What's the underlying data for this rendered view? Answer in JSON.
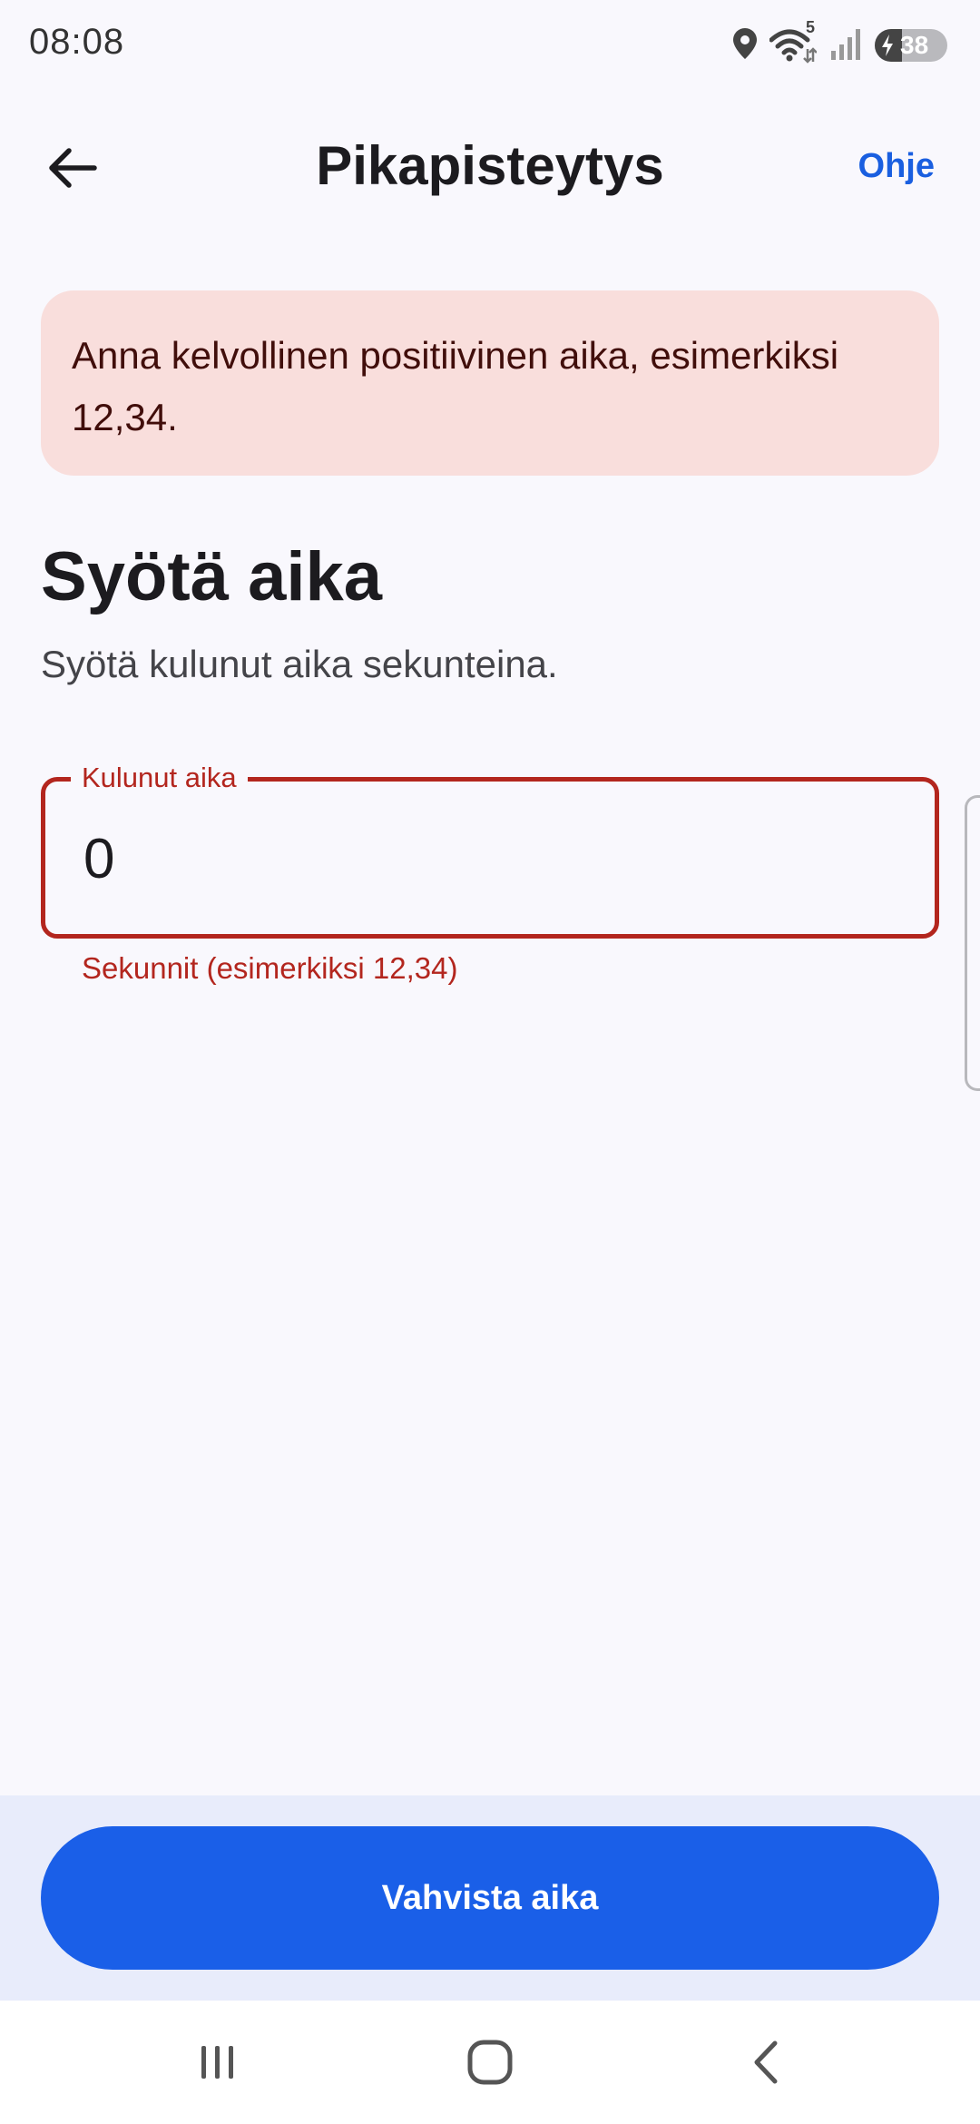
{
  "status_bar": {
    "time": "08:08",
    "wifi_badge": "5",
    "battery_level": "38",
    "icons": [
      "location-icon",
      "wifi-icon",
      "signal-icon",
      "battery-icon"
    ]
  },
  "app_bar": {
    "title": "Pikapisteytys",
    "help_label": "Ohje",
    "back_icon": "arrow-left-icon"
  },
  "error_banner": {
    "message": "Anna kelvollinen positiivinen aika, esimerkiksi 12,34."
  },
  "section": {
    "title": "Syötä aika",
    "subtitle": "Syötä kulunut aika sekunteina."
  },
  "time_field": {
    "label": "Kulunut aika",
    "value": "0",
    "supporting_text": "Sekunnit (esimerkiksi 12,34)",
    "state": "error"
  },
  "actions": {
    "confirm_label": "Vahvista aika"
  },
  "nav_bar": {
    "icons": [
      "recents-icon",
      "home-icon",
      "back-icon"
    ]
  },
  "colors": {
    "background": "#f9f8fd",
    "primary": "#1a5fe8",
    "error": "#b3261e",
    "error_container": "#f9dedc",
    "bottom_area": "#e8ecfb"
  }
}
